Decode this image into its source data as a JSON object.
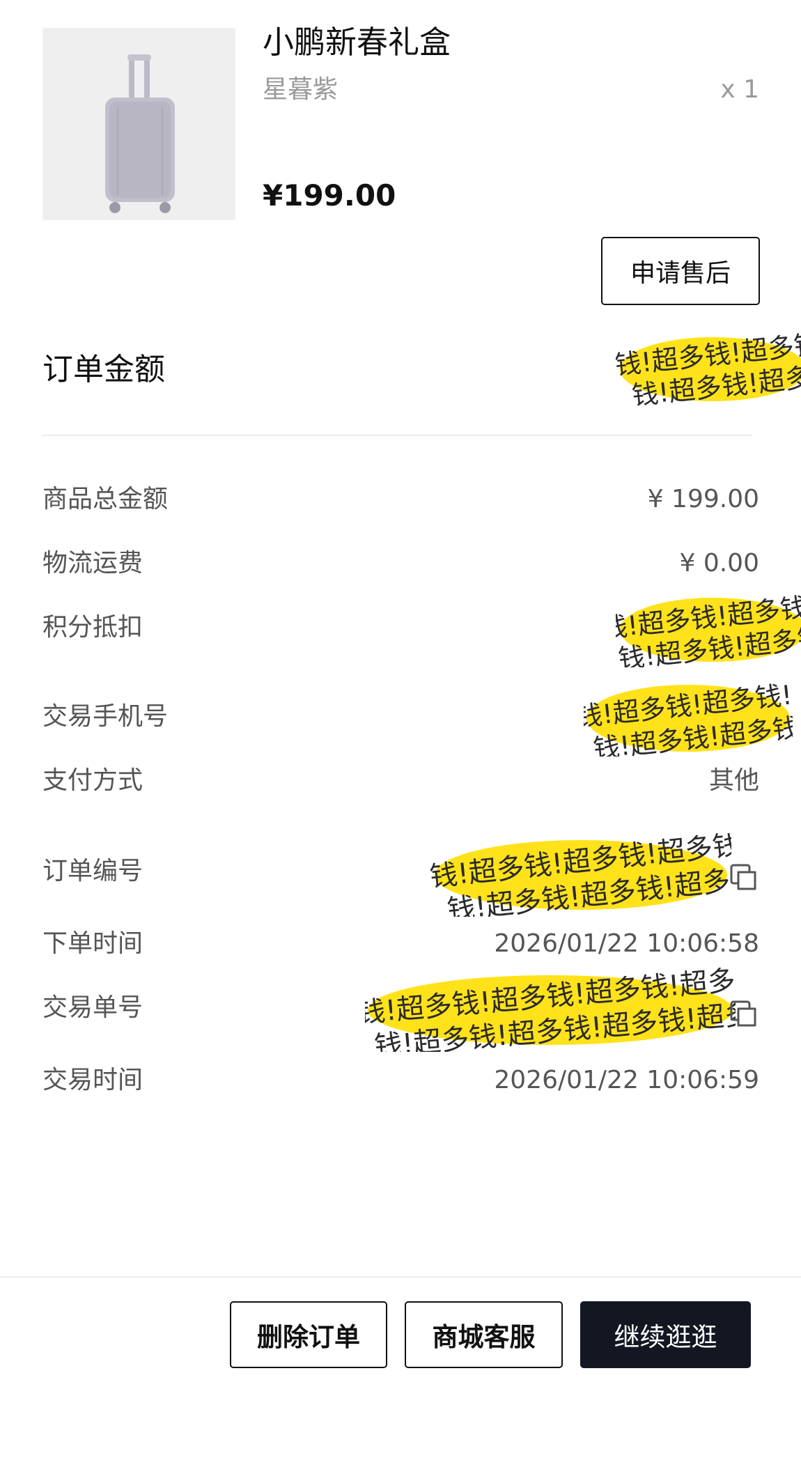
{
  "product": {
    "image_icon": "suitcase-image",
    "name": "小鹏新春礼盒",
    "variant": "星暮紫",
    "quantity": "x 1",
    "price": "¥199.00",
    "after_sale_label": "申请售后"
  },
  "order_amount": {
    "title": "订单金额"
  },
  "details": {
    "goods_total_label": "商品总金额",
    "goods_total_value": "¥ 199.00",
    "shipping_label": "物流运费",
    "shipping_value": "¥ 0.00",
    "points_label": "积分抵扣",
    "phone_label": "交易手机号",
    "payment_method_label": "支付方式",
    "payment_method_value": "其他",
    "order_number_label": "订单编号",
    "order_time_label": "下单时间",
    "order_time_value": "2026/01/22 10:06:58",
    "transaction_number_label": "交易单号",
    "transaction_time_label": "交易时间",
    "transaction_time_value": "2026/01/22 10:06:59"
  },
  "redaction_text": "钱!超多钱!超多钱!超多钱!超多钱!超多",
  "actions": {
    "delete_label": "删除订单",
    "service_label": "商城客服",
    "continue_label": "继续逛逛"
  },
  "colors": {
    "redaction_yellow": "#ffe21a",
    "primary_button": "#121722"
  }
}
